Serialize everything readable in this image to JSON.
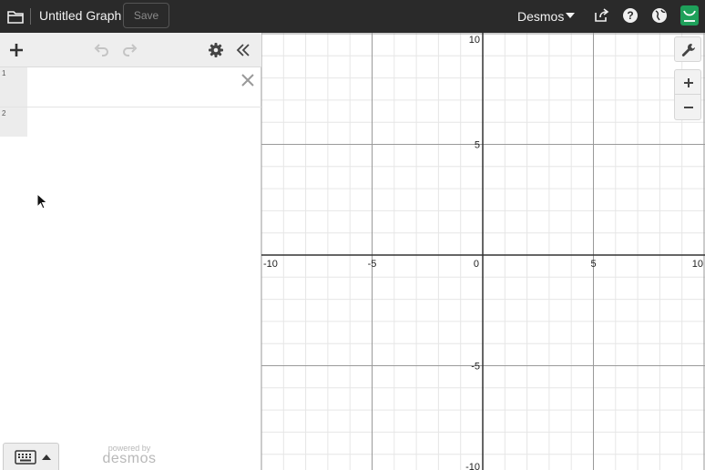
{
  "header": {
    "graph_title": "Untitled Graph",
    "save_label": "Save",
    "brand_menu": "Desmos",
    "icons": [
      "folder-icon",
      "share-icon",
      "help-icon",
      "globe-icon",
      "extension-icon"
    ]
  },
  "expressions": {
    "rows": [
      {
        "index": "1",
        "value": ""
      },
      {
        "index": "2",
        "value": ""
      }
    ],
    "toolbar_icons": [
      "add-icon",
      "undo-icon",
      "redo-icon",
      "gear-icon",
      "collapse-icon"
    ]
  },
  "keypad": {
    "icon": "keyboard-icon"
  },
  "footer": {
    "powered_by": "powered by",
    "brand": "desmos"
  },
  "graph": {
    "x_range": [
      -10,
      10
    ],
    "y_range": [
      -10,
      10
    ],
    "major_step": 5,
    "minor_step": 1,
    "x_ticks": [
      "-10",
      "-5",
      "0",
      "5",
      "10"
    ],
    "y_ticks": [
      "10",
      "5",
      "-5",
      "-10"
    ],
    "controls": [
      "wrench-icon",
      "zoom-in-icon",
      "zoom-out-icon"
    ]
  },
  "colors": {
    "header_bg": "#2a2a2a",
    "extension_green": "#1ea05a",
    "toolbar_bg": "#eeeeee"
  }
}
